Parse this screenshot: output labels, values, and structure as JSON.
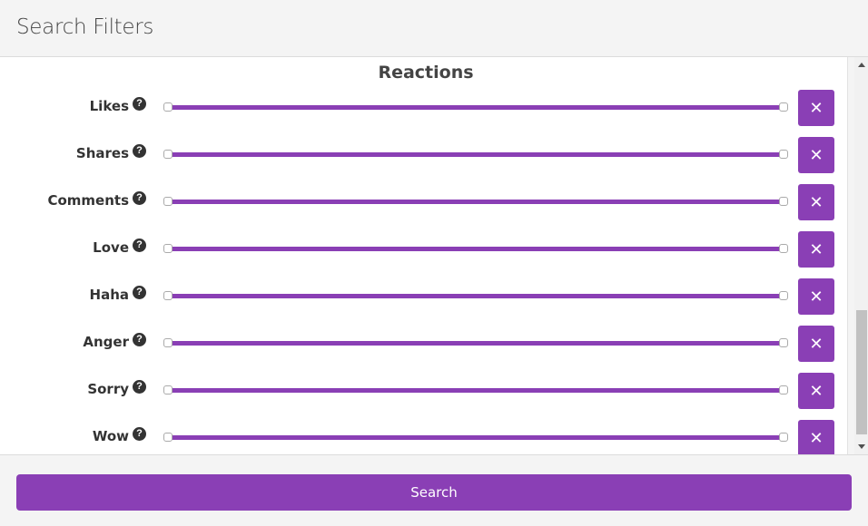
{
  "header": {
    "title": "Search Filters"
  },
  "section": {
    "title": "Reactions"
  },
  "filters": [
    {
      "label": "Likes",
      "help_icon": "question-circle-icon",
      "range_min": 0,
      "range_max": 1,
      "clear_icon": "close-icon"
    },
    {
      "label": "Shares",
      "help_icon": "question-circle-icon",
      "range_min": 0,
      "range_max": 1,
      "clear_icon": "close-icon"
    },
    {
      "label": "Comments",
      "help_icon": "question-circle-icon",
      "range_min": 0,
      "range_max": 1,
      "clear_icon": "close-icon"
    },
    {
      "label": "Love",
      "help_icon": "question-circle-icon",
      "range_min": 0,
      "range_max": 1,
      "clear_icon": "close-icon"
    },
    {
      "label": "Haha",
      "help_icon": "question-circle-icon",
      "range_min": 0,
      "range_max": 1,
      "clear_icon": "close-icon"
    },
    {
      "label": "Anger",
      "help_icon": "question-circle-icon",
      "range_min": 0,
      "range_max": 1,
      "clear_icon": "close-icon"
    },
    {
      "label": "Sorry",
      "help_icon": "question-circle-icon",
      "range_min": 0,
      "range_max": 1,
      "clear_icon": "close-icon"
    },
    {
      "label": "Wow",
      "help_icon": "question-circle-icon",
      "range_min": 0,
      "range_max": 1,
      "clear_icon": "close-icon"
    }
  ],
  "icons": {
    "help": "?",
    "clear": "✕"
  },
  "footer": {
    "search_label": "Search"
  },
  "colors": {
    "accent": "#8a3fb5",
    "header_bg": "#f4f4f4",
    "text": "#333333"
  }
}
